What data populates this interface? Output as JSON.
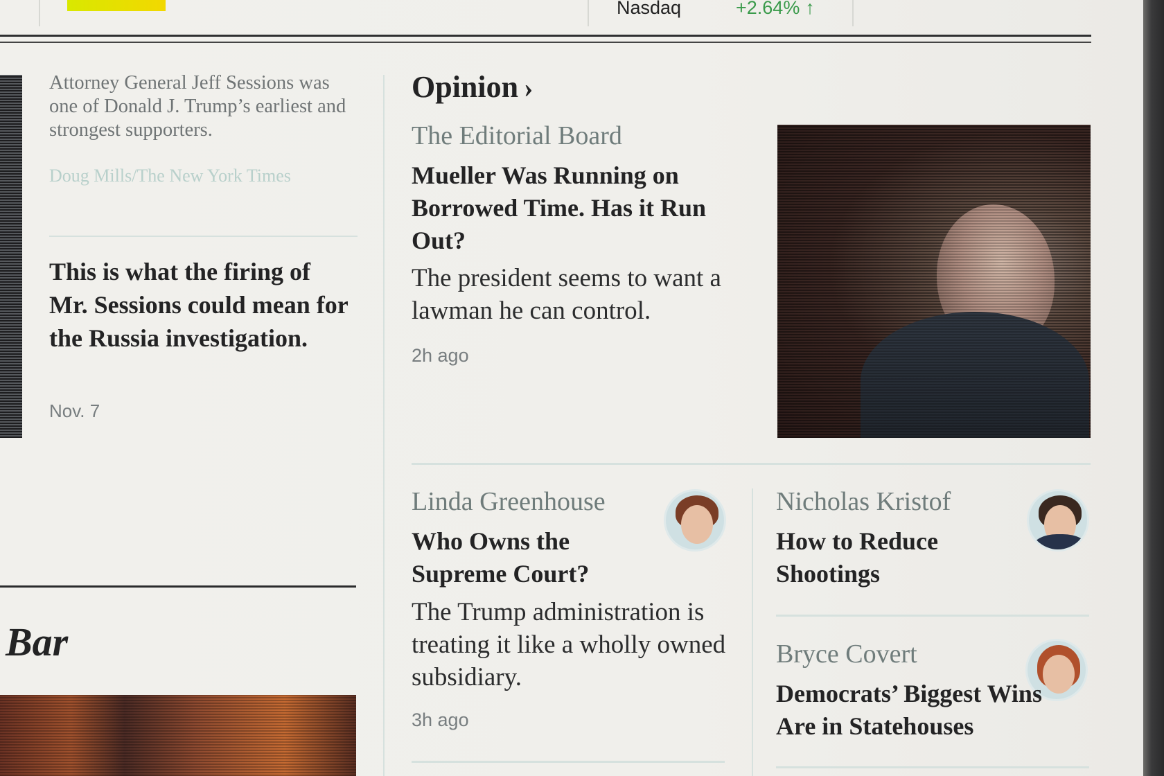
{
  "market": {
    "name": "Nasdaq",
    "change": "+2.64%",
    "arrow": "↑",
    "up_color": "#3a9a4b"
  },
  "left_column": {
    "caption": "Attorney General Jeff Sessions was one of Donald J. Trump’s earliest and strongest supporters.",
    "credit": "Doug Mills/The New York Times",
    "headline": "This is what the firing of Mr. Sessions could mean for the Russia investigation.",
    "timestamp": "Nov. 7",
    "section_title": "Bar"
  },
  "opinion": {
    "section_label": "Opinion",
    "chevron": "›",
    "lead": {
      "byline": "The Editorial Board",
      "headline": "Mueller Was Running on Borrowed Time. Has it Run Out?",
      "summary": "The president seems to want a lawman he can control.",
      "timestamp": "2h ago"
    },
    "columns": [
      {
        "byline": "Linda Greenhouse",
        "headline": "Who Owns the Supreme Court?",
        "summary": "The Trump administration is treating it like a wholly owned subsidiary.",
        "timestamp": "3h ago"
      },
      {
        "byline": "Nicholas Kristof",
        "headline": "How to Reduce Shootings"
      },
      {
        "byline": "Bryce Covert",
        "headline": "Democrats’ Biggest Wins Are in Statehouses"
      }
    ]
  }
}
